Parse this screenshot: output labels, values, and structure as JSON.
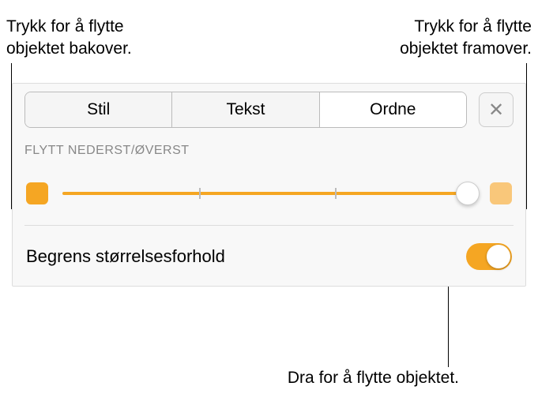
{
  "callouts": {
    "back_line1": "Trykk for å flytte",
    "back_line2": "objektet bakover.",
    "front_line1": "Trykk for å flytte",
    "front_line2": "objektet framover.",
    "drag": "Dra for å flytte objektet."
  },
  "tabs": {
    "style": "Stil",
    "text": "Tekst",
    "arrange": "Ordne"
  },
  "section": {
    "header": "FLYTT NEDERST/ØVERST"
  },
  "toggle": {
    "label": "Begrens størrelsesforhold"
  },
  "close": "✕"
}
